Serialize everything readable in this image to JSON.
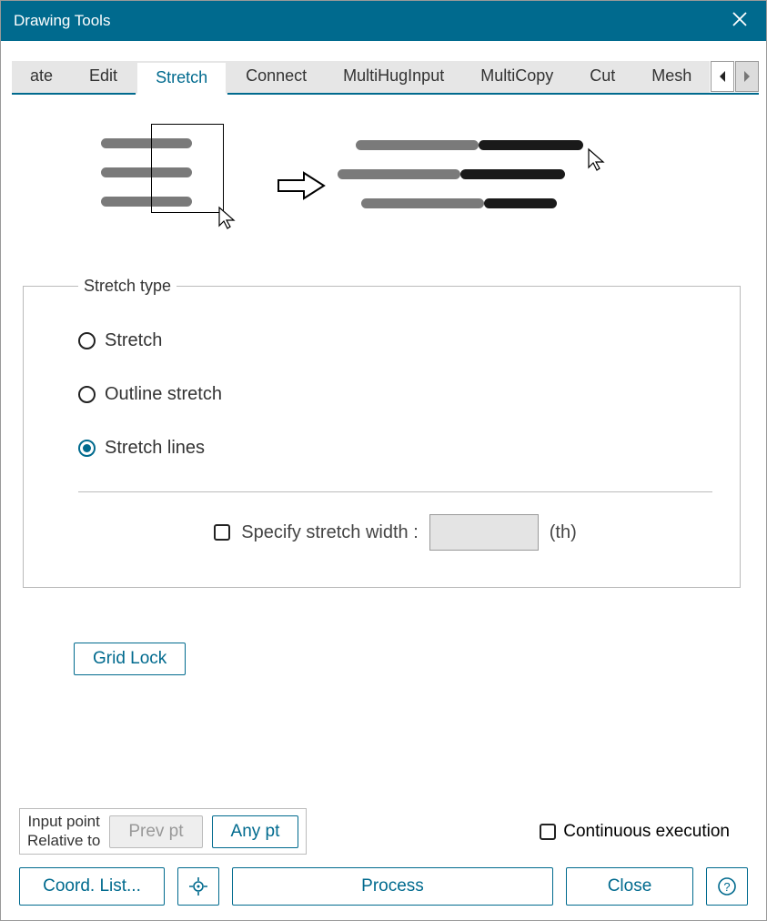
{
  "window": {
    "title": "Drawing Tools"
  },
  "tabs": {
    "items": [
      "ate",
      "Edit",
      "Stretch",
      "Connect",
      "MultiHugInput",
      "MultiCopy",
      "Cut",
      "Mesh"
    ],
    "active_index": 2
  },
  "stretch_type": {
    "legend": "Stretch type",
    "options": {
      "stretch": "Stretch",
      "outline": "Outline stretch",
      "lines": "Stretch lines"
    },
    "selected": "lines",
    "specify_width_label": "Specify stretch width  :",
    "width_unit": "(th)",
    "width_value": ""
  },
  "buttons": {
    "grid_lock": "Grid Lock",
    "prev_pt": "Prev pt",
    "any_pt": "Any pt",
    "coord_list": "Coord. List...",
    "process": "Process",
    "close": "Close"
  },
  "input_point": {
    "label_line1": "Input point",
    "label_line2": "Relative to"
  },
  "continuous_execution": "Continuous execution"
}
